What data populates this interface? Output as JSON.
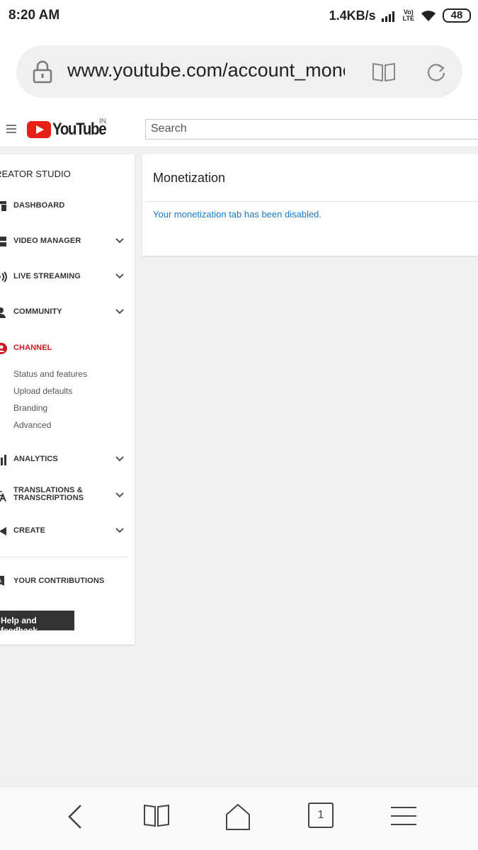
{
  "status_bar": {
    "time": "8:20 AM",
    "net_speed": "1.4KB/s",
    "lte_label_1": "Vo)",
    "lte_label_2": "LTE",
    "battery": "48"
  },
  "browser": {
    "url": "www.youtube.com/account_mone",
    "tab_count": "1"
  },
  "header": {
    "logo_text": "YouTube",
    "country": "IN",
    "search_placeholder": "Search"
  },
  "sidebar": {
    "title": "REATOR STUDIO",
    "items": [
      {
        "label": "DASHBOARD"
      },
      {
        "label": "VIDEO MANAGER"
      },
      {
        "label": "LIVE STREAMING"
      },
      {
        "label": "COMMUNITY"
      },
      {
        "label": "CHANNEL"
      },
      {
        "label": "ANALYTICS"
      },
      {
        "label_line1": "TRANSLATIONS &",
        "label_line2": "TRANSCRIPTIONS"
      },
      {
        "label": "CREATE"
      },
      {
        "label": "YOUR CONTRIBUTIONS"
      }
    ],
    "channel_subitems": [
      "Status and features",
      "Upload defaults",
      "Branding",
      "Advanced"
    ],
    "help_button": "Help and feedback"
  },
  "main": {
    "title": "Monetization",
    "message": "Your monetization tab has been disabled."
  },
  "colors": {
    "brand_red": "#e62117",
    "active_red": "#cc181e",
    "link_blue": "#167ac6",
    "page_bg": "#f1f1f1"
  }
}
